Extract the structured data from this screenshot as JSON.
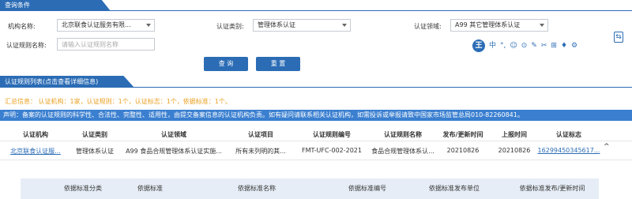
{
  "query": {
    "title": "查询条件",
    "org_label": "机构名称:",
    "org_value": "北京联食认证服务有限...",
    "cert_type_label": "认证类别:",
    "cert_type_value": "管理体系认证",
    "cert_field_label": "认证领域:",
    "cert_field_value": "A99 其它管理体系认证",
    "rule_name_label": "认证规则名称:",
    "rule_name_placeholder": "请输入认证规则名称",
    "search_btn": "查 询",
    "reset_btn": "重 置"
  },
  "toolbar": {
    "badge": "王",
    "icons": [
      "中",
      "°,",
      "☺",
      "⊙",
      "✎",
      "✂",
      "⊞",
      "♦",
      "⚙"
    ]
  },
  "side_icon": "⇆",
  "rules": {
    "title": "认证规则列表(点击查看详细信息)",
    "summary": "汇总信息：  认证机构：1家，认证规则：1个，认证标志：1个，依据标准：1个。",
    "notice": "声明：备案的认证规则的科学性、合法性、完整性、适用性，由提交备案信息的认证机构负责。如有疑问请联系相关认证机构，如需投诉或举报请致中国家市场监管总局010-82260841。",
    "columns": [
      "认证机构",
      "认证类别",
      "认证领域",
      "认证项目",
      "认证规则编号",
      "认证规则名称",
      "发布/更新时间",
      "上报时间",
      "认证标志"
    ],
    "row": [
      "北京联食认证服...",
      "管理体系认证",
      "A99 食品合规管理体系认证实施...",
      "所有未列明的其...",
      "FMT-UFC-002-2021",
      "食品合规管理体系认...",
      "20210826",
      "20210826",
      "16299450345617..."
    ],
    "expand_icon": "^",
    "sub_columns": [
      "依据标准分类",
      "依据标准",
      "依据标准名称",
      "依据标准编号",
      "依据标准发布单位",
      "依据标准发布/更新时间"
    ]
  }
}
